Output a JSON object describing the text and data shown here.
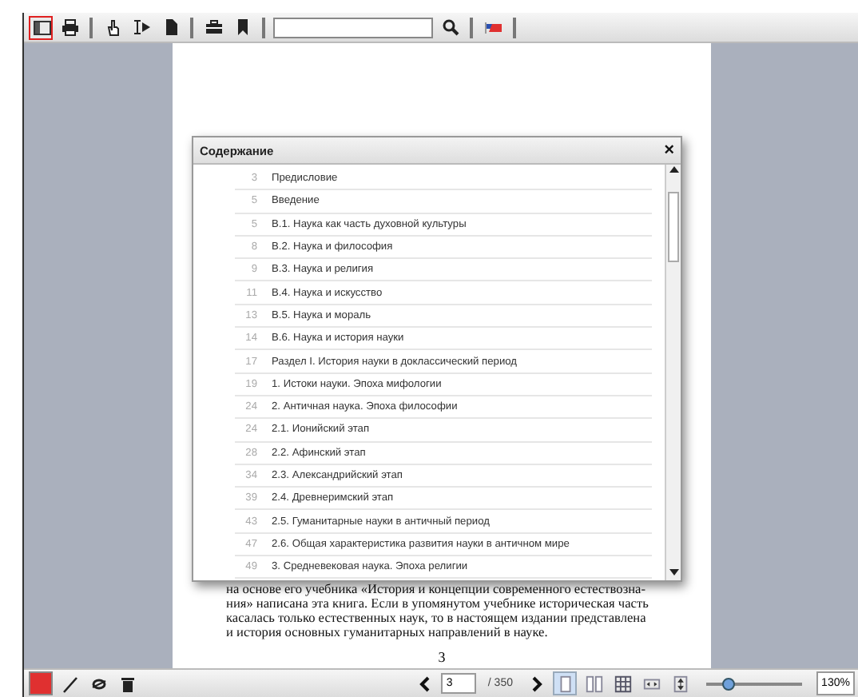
{
  "toolbar": {
    "tools": [
      {
        "selected": true
      },
      {
        "selected": false
      },
      {
        "selected": false
      },
      {
        "selected": false
      },
      {
        "selected": false
      },
      {
        "selected": false
      },
      {
        "selected": false
      }
    ]
  },
  "document": {
    "lines": [
      "на основе его учебника «История и концепции современного естествозна-",
      "ния» написана эта книга. Если в упомянутом учебнике историческая часть",
      "касалась только естественных наук, то в настоящем издании представлена",
      "и история основных гуманитарных направлений в науке."
    ],
    "page_number": "3"
  },
  "contents_dialog": {
    "title": "Содержание",
    "close": "×",
    "entries": [
      {
        "page": "3",
        "title": "Предисловие"
      },
      {
        "page": "5",
        "title": "Введение"
      },
      {
        "page": "5",
        "title": "В.1. Наука как часть духовной культуры"
      },
      {
        "page": "8",
        "title": "В.2. Наука и философия"
      },
      {
        "page": "9",
        "title": "В.3. Наука и религия"
      },
      {
        "page": "11",
        "title": "В.4. Наука и искусство"
      },
      {
        "page": "13",
        "title": "В.5. Наука и мораль"
      },
      {
        "page": "14",
        "title": "В.6. Наука и история науки"
      },
      {
        "page": "17",
        "title": "Раздел I. История науки в доклассический период"
      },
      {
        "page": "19",
        "title": "1. Истоки науки. Эпоха мифологии"
      },
      {
        "page": "24",
        "title": "2. Античная наука. Эпоха философии"
      },
      {
        "page": "24",
        "title": "2.1. Ионийский этап"
      },
      {
        "page": "28",
        "title": "2.2. Афинский этап"
      },
      {
        "page": "34",
        "title": "2.3. Александрийский этап"
      },
      {
        "page": "39",
        "title": "2.4. Древнеримский этап"
      },
      {
        "page": "43",
        "title": "2.5. Гуманитарные науки в античный период"
      },
      {
        "page": "47",
        "title": "2.6. Общая характеристика развития науки в античном мире"
      },
      {
        "page": "49",
        "title": "3. Средневековая наука. Эпоха религии"
      }
    ]
  },
  "bottom_bar": {
    "current_page": "3",
    "total_pages": "/ 350",
    "views": [
      {
        "selected": true
      },
      {
        "selected": false
      },
      {
        "selected": false
      },
      {
        "selected": false
      },
      {
        "selected": false
      }
    ],
    "zoom": {
      "level": 0.23,
      "reading": "130%"
    }
  }
}
